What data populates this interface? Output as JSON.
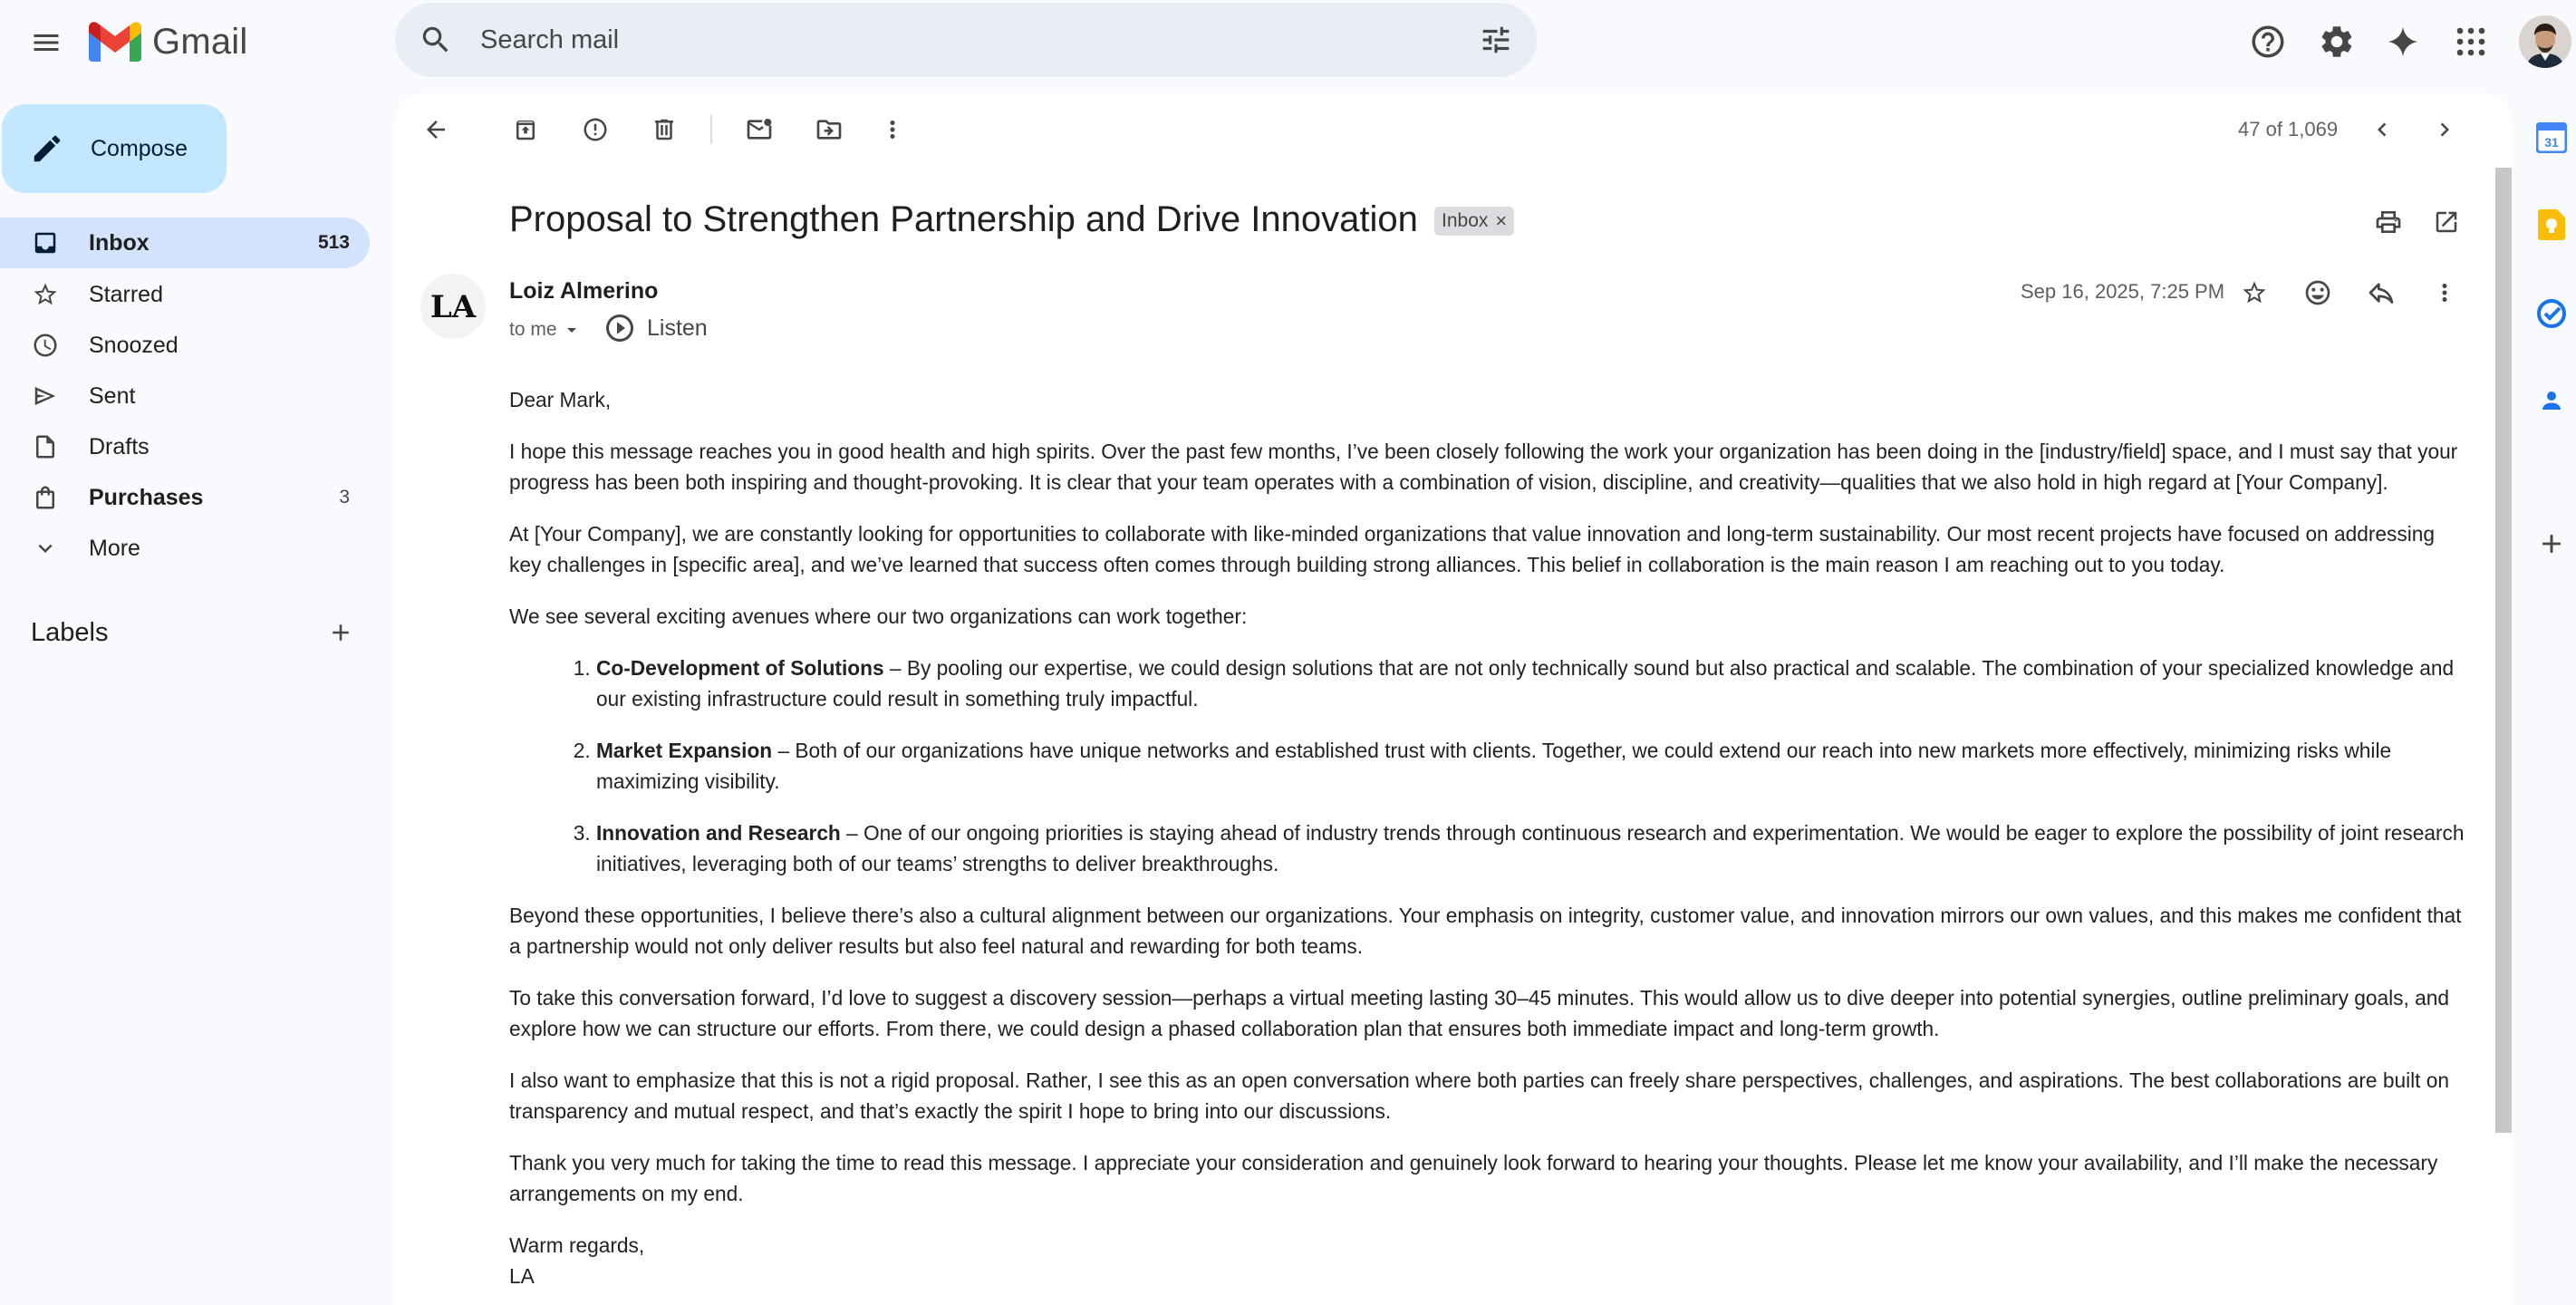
{
  "app": {
    "name": "Gmail"
  },
  "search": {
    "placeholder": "Search mail"
  },
  "compose": {
    "label": "Compose"
  },
  "nav": [
    {
      "label": "Inbox",
      "count": "513",
      "icon": "inbox-icon"
    },
    {
      "label": "Starred",
      "count": "",
      "icon": "star-icon"
    },
    {
      "label": "Snoozed",
      "count": "",
      "icon": "clock-icon"
    },
    {
      "label": "Sent",
      "count": "",
      "icon": "send-icon"
    },
    {
      "label": "Drafts",
      "count": "",
      "icon": "draft-icon"
    },
    {
      "label": "Purchases",
      "count": "3",
      "icon": "shopping-bag-icon"
    },
    {
      "label": "More",
      "count": "",
      "icon": "chevron-down-icon"
    }
  ],
  "labels": {
    "title": "Labels"
  },
  "toolbar": {
    "pager": "47 of 1,069"
  },
  "email": {
    "subject": "Proposal to Strengthen Partnership and Drive Innovation",
    "chip": "Inbox",
    "chip_close": "×",
    "sender": "Loiz Almerino",
    "avatar_monogram": "LA",
    "to": "to me",
    "listen": "Listen",
    "date": "Sep 16, 2025, 7:25 PM",
    "greeting": "Dear Mark,",
    "p1": "I hope this message reaches you in good health and high spirits. Over the past few months, I’ve been closely following the work your organization has been doing in the [industry/field] space, and I must say that your progress has been both inspiring and thought-provoking. It is clear that your team operates with a combination of vision, discipline, and creativity—qualities that we also hold in high regard at [Your Company].",
    "p2": "At [Your Company], we are constantly looking for opportunities to collaborate with like-minded organizations that value innovation and long-term sustainability. Our most recent projects have focused on addressing key challenges in [specific area], and we’ve learned that success often comes through building strong alliances. This belief in collaboration is the main reason I am reaching out to you today.",
    "p3": "We see several exciting avenues where our two organizations can work together:",
    "items": [
      {
        "title": "Co-Development of Solutions",
        "text": " – By pooling our expertise, we could design solutions that are not only technically sound but also practical and scalable. The combination of your specialized knowledge and our existing infrastructure could result in something truly impactful."
      },
      {
        "title": "Market Expansion",
        "text": " – Both of our organizations have unique networks and established trust with clients. Together, we could extend our reach into new markets more effectively, minimizing risks while maximizing visibility."
      },
      {
        "title": "Innovation and Research",
        "text": " – One of our ongoing priorities is staying ahead of industry trends through continuous research and experimentation. We would be eager to explore the possibility of joint research initiatives, leveraging both of our teams’ strengths to deliver breakthroughs."
      }
    ],
    "p4": "Beyond these opportunities, I believe there’s also a cultural alignment between our organizations. Your emphasis on integrity, customer value, and innovation mirrors our own values, and this makes me confident that a partnership would not only deliver results but also feel natural and rewarding for both teams.",
    "p5": "To take this conversation forward, I’d love to suggest a discovery session—perhaps a virtual meeting lasting 30–45 minutes. This would allow us to dive deeper into potential synergies, outline preliminary goals, and explore how we can structure our efforts. From there, we could design a phased collaboration plan that ensures both immediate impact and long-term growth.",
    "p6": "I also want to emphasize that this is not a rigid proposal. Rather, I see this as an open conversation where both parties can freely share perspectives, challenges, and aspirations. The best collaborations are built on transparency and mutual respect, and that’s exactly the spirit I hope to bring into our discussions.",
    "p7": "Thank you very much for taking the time to read this message. I appreciate your consideration and genuinely look forward to hearing your thoughts. Please let me know your availability, and I’ll make the necessary arrangements on my end.",
    "signoff": "Warm regards,",
    "signature": "LA"
  },
  "side_panel": {
    "calendar_day": "31"
  },
  "colors": {
    "background": "#f8fafd",
    "compose": "#c2e7ff",
    "nav_active": "#d3e3fd",
    "search_bg": "#e9eef6",
    "gmail_red": "#ea4335",
    "gmail_blue": "#4285f4",
    "gmail_green": "#34a853",
    "gmail_yellow": "#fbbc04"
  }
}
